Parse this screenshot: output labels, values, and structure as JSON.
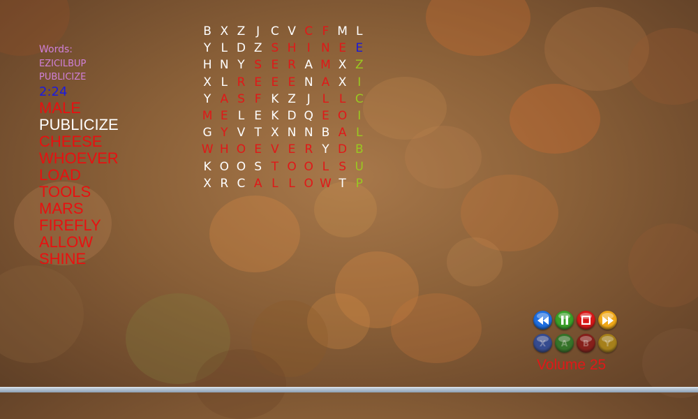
{
  "words_label": "Words:",
  "found_words": [
    "EZICILBUP",
    "PUBLICIZE"
  ],
  "timer": "2:24",
  "word_list": [
    {
      "text": "MALE",
      "color": "#e81010"
    },
    {
      "text": "PUBLICIZE",
      "color": "#ffffff"
    },
    {
      "text": "CHEESE",
      "color": "#e81010"
    },
    {
      "text": "WHOEVER",
      "color": "#e81010"
    },
    {
      "text": "LOAD",
      "color": "#e81010"
    },
    {
      "text": "TOOLS",
      "color": "#e81010"
    },
    {
      "text": "MARS",
      "color": "#e81010"
    },
    {
      "text": "FIREFLY",
      "color": "#e81010"
    },
    {
      "text": "ALLOW",
      "color": "#e81010"
    },
    {
      "text": "SHINE",
      "color": "#e81010"
    }
  ],
  "grid": {
    "rows": [
      "BXZJCVCFML",
      "YLDZSHINEE",
      "HNYSERAMXZ",
      "XLREEENAXI",
      "YASFKZJLLC",
      "MELEKDQEOI",
      "GYVTXNNBAL",
      "WHOEVERYDB",
      "KOOSTOOLSU",
      "XRCALLOWTP"
    ],
    "colors": [
      "wwwwwwrrww",
      "wwwwrrrrrb",
      "wwwrrrwrwg",
      "wwrrrrwrwg",
      "wrrrwwwrrg",
      "rrwwwwwrrg",
      "wrwwwwwwrg",
      "rrrrrrrwrg",
      "wwwwrrrrrg",
      "wwwrrrrrwg"
    ],
    "palette": {
      "w": "#ffffff",
      "r": "#e01818",
      "b": "#1a1ad8",
      "g": "#9ac820"
    }
  },
  "controls": {
    "media_buttons": [
      {
        "name": "rewind-button",
        "icon": "rewind-icon",
        "color": "#1e6ee0"
      },
      {
        "name": "pause-button",
        "icon": "pause-icon",
        "color": "#3aa028"
      },
      {
        "name": "stop-button",
        "icon": "stop-icon",
        "color": "#d81818"
      },
      {
        "name": "fast-forward-button",
        "icon": "fast-forward-icon",
        "color": "#f0a818"
      }
    ],
    "gamepad_buttons": [
      {
        "name": "x-button",
        "label": "X",
        "color": "#2a4aa0"
      },
      {
        "name": "a-button",
        "label": "A",
        "color": "#2a7a28"
      },
      {
        "name": "b-button",
        "label": "B",
        "color": "#8a1818"
      },
      {
        "name": "y-button",
        "label": "Y",
        "color": "#b08a18"
      }
    ],
    "volume_label": "Volume 25"
  }
}
